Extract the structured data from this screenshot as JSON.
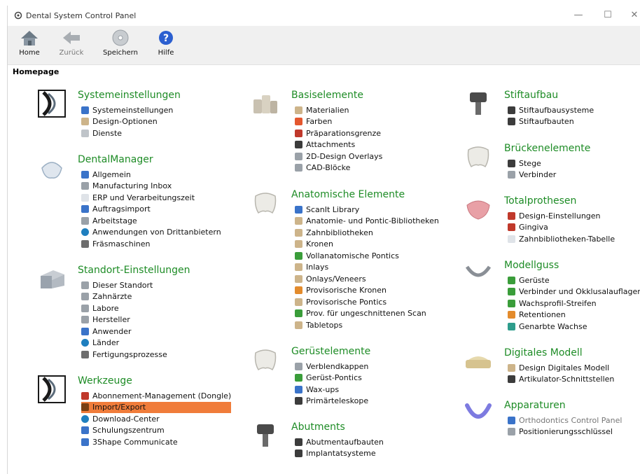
{
  "window": {
    "title": "Dental System Control Panel"
  },
  "toolbar": {
    "home": "Home",
    "back": "Zurück",
    "save": "Speichern",
    "help": "Hilfe"
  },
  "page_title": "Homepage",
  "columns": [
    [
      {
        "key": "sys",
        "title": "Systemeinstellungen",
        "image": "control-panel-logo",
        "items": [
          {
            "label": "Systemeinstellungen",
            "icon": "blue"
          },
          {
            "label": "Design-Optionen",
            "icon": "tan"
          },
          {
            "label": "Dienste",
            "icon": "gear"
          }
        ]
      },
      {
        "key": "dm",
        "title": "DentalManager",
        "image": "dental-manager-image",
        "items": [
          {
            "label": "Allgemein",
            "icon": "blue"
          },
          {
            "label": "Manufacturing Inbox",
            "icon": "grey"
          },
          {
            "label": "ERP und Verarbeitungszeit",
            "icon": "doc"
          },
          {
            "label": "Auftragsimport",
            "icon": "blue"
          },
          {
            "label": "Arbeitstage",
            "icon": "grey"
          },
          {
            "label": "Anwendungen von Drittanbietern",
            "icon": "globe"
          },
          {
            "label": "Fräsmaschinen",
            "icon": "pen"
          }
        ]
      },
      {
        "key": "loc",
        "title": "Standort-Einstellungen",
        "image": "building-image",
        "items": [
          {
            "label": "Dieser Standort",
            "icon": "grey"
          },
          {
            "label": "Zahnärzte",
            "icon": "grey"
          },
          {
            "label": "Labore",
            "icon": "grey"
          },
          {
            "label": "Hersteller",
            "icon": "grey"
          },
          {
            "label": "Anwender",
            "icon": "blue"
          },
          {
            "label": "Länder",
            "icon": "globe"
          },
          {
            "label": "Fertigungsprozesse",
            "icon": "pen"
          }
        ]
      },
      {
        "key": "tools",
        "title": "Werkzeuge",
        "image": "control-panel-logo",
        "items": [
          {
            "label": "Abonnement-Management (Dongle)",
            "icon": "red"
          },
          {
            "label": "Import/Export",
            "icon": "tool",
            "selected": true
          },
          {
            "label": "Download-Center",
            "icon": "globe"
          },
          {
            "label": "Schulungszentrum",
            "icon": "blue"
          },
          {
            "label": "3Shape Communicate",
            "icon": "blue"
          }
        ]
      }
    ],
    [
      {
        "key": "base",
        "title": "Basiselemente",
        "image": "bottles-image",
        "items": [
          {
            "label": "Materialien",
            "icon": "tan"
          },
          {
            "label": "Farben",
            "icon": "rainbow"
          },
          {
            "label": "Präparationsgrenze",
            "icon": "red"
          },
          {
            "label": "Attachments",
            "icon": "dark"
          },
          {
            "label": "2D-Design Overlays",
            "icon": "grey"
          },
          {
            "label": "CAD-Blöcke",
            "icon": "grey"
          }
        ]
      },
      {
        "key": "anat",
        "title": "Anatomische Elemente",
        "image": "tooth-image",
        "items": [
          {
            "label": "ScanIt Library",
            "icon": "blue"
          },
          {
            "label": "Anatomie- und Pontic-Bibliotheken",
            "icon": "tan"
          },
          {
            "label": "Zahnbibliotheken",
            "icon": "tan"
          },
          {
            "label": "Kronen",
            "icon": "tan"
          },
          {
            "label": "Vollanatomische Pontics",
            "icon": "green"
          },
          {
            "label": "Inlays",
            "icon": "tan"
          },
          {
            "label": "Onlays/Veneers",
            "icon": "tan"
          },
          {
            "label": "Provisorische Kronen",
            "icon": "orange"
          },
          {
            "label": "Provisorische Pontics",
            "icon": "tan"
          },
          {
            "label": "Prov. für ungeschnittenen Scan",
            "icon": "green"
          },
          {
            "label": "Tabletops",
            "icon": "tan"
          }
        ]
      },
      {
        "key": "frame",
        "title": "Gerüstelemente",
        "image": "tooth-cap-image",
        "items": [
          {
            "label": "Verblendkappen",
            "icon": "grey"
          },
          {
            "label": "Gerüst-Pontics",
            "icon": "green"
          },
          {
            "label": "Wax-ups",
            "icon": "blue"
          },
          {
            "label": "Primärteleskope",
            "icon": "dark"
          }
        ]
      },
      {
        "key": "abut",
        "title": "Abutments",
        "image": "abutment-image",
        "items": [
          {
            "label": "Abutmentaufbauten",
            "icon": "dark"
          },
          {
            "label": "Implantatsysteme",
            "icon": "dark"
          }
        ]
      }
    ],
    [
      {
        "key": "post",
        "title": "Stiftaufbau",
        "image": "post-image",
        "items": [
          {
            "label": "Stiftaufbausysteme",
            "icon": "dark"
          },
          {
            "label": "Stiftaufbauten",
            "icon": "dark"
          }
        ]
      },
      {
        "key": "bridge",
        "title": "Brückenelemente",
        "image": "bridge-image",
        "items": [
          {
            "label": "Stege",
            "icon": "dark"
          },
          {
            "label": "Verbinder",
            "icon": "grey"
          }
        ]
      },
      {
        "key": "denture",
        "title": "Totalprothesen",
        "image": "denture-image",
        "items": [
          {
            "label": "Design-Einstellungen",
            "icon": "red"
          },
          {
            "label": "Gingiva",
            "icon": "red"
          },
          {
            "label": "Zahnbibliotheken-Tabelle",
            "icon": "doc"
          }
        ]
      },
      {
        "key": "rpd",
        "title": "Modellguss",
        "image": "rpd-image",
        "items": [
          {
            "label": "Gerüste",
            "icon": "green"
          },
          {
            "label": "Verbinder und Okklusalauflagen",
            "icon": "green"
          },
          {
            "label": "Wachsprofil-Streifen",
            "icon": "green"
          },
          {
            "label": "Retentionen",
            "icon": "orange"
          },
          {
            "label": "Genarbte Wachse",
            "icon": "teal"
          }
        ]
      },
      {
        "key": "digi",
        "title": "Digitales Modell",
        "image": "model-image",
        "items": [
          {
            "label": "Design Digitales Modell",
            "icon": "tan"
          },
          {
            "label": "Artikulator-Schnittstellen",
            "icon": "dark"
          }
        ]
      },
      {
        "key": "ortho",
        "title": "Apparaturen",
        "image": "aligner-image",
        "items": [
          {
            "label": "Orthodontics Control Panel",
            "icon": "blue",
            "grey": true
          },
          {
            "label": "Positionierungsschlüssel",
            "icon": "grey"
          }
        ]
      }
    ]
  ],
  "colors": {
    "section_title": "#1e8c26",
    "selection": "#f07c3a",
    "toolbar_bg": "#f0f0f0"
  }
}
